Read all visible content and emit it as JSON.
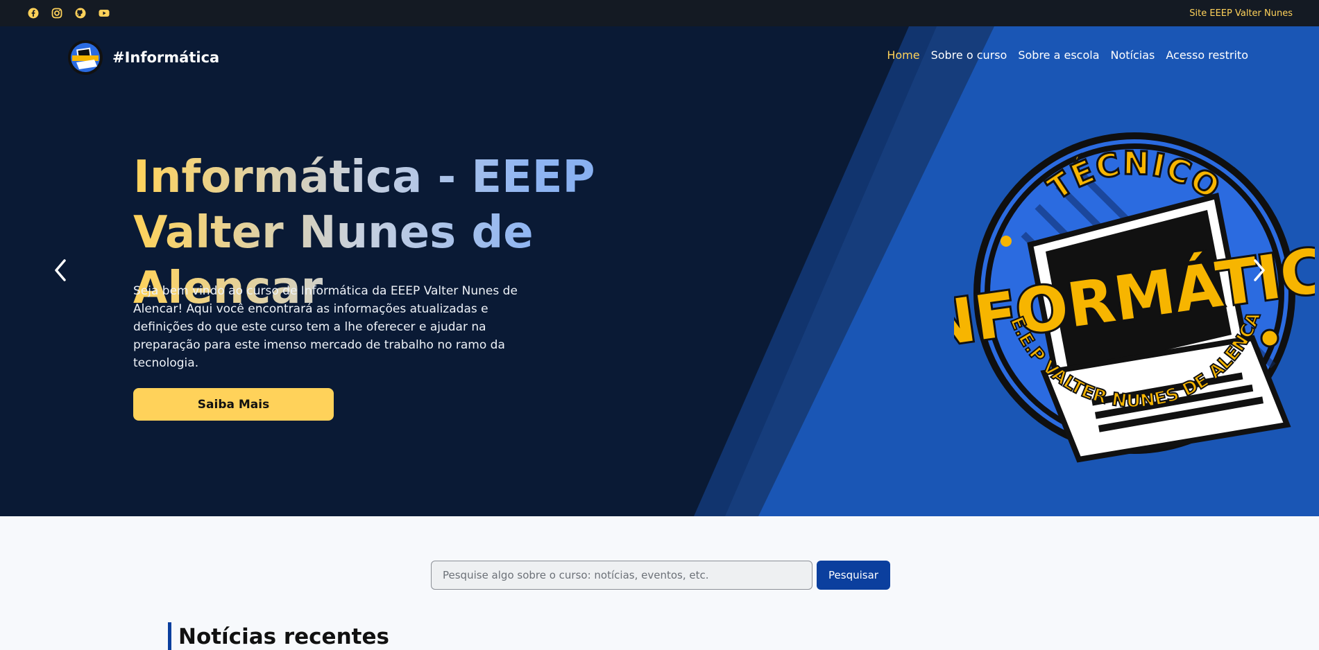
{
  "topbar": {
    "social": [
      "facebook-icon",
      "instagram-icon",
      "github-icon",
      "youtube-icon"
    ],
    "site_link": "Site EEEP Valter Nunes"
  },
  "header": {
    "brand": "#Informática",
    "nav": [
      "Home",
      "Sobre o curso",
      "Sobre a escola",
      "Notícias",
      "Acesso restrito"
    ],
    "active_nav": "Home"
  },
  "hero": {
    "title": "Informática - EEEP Valter Nunes de Alencar",
    "description": "Seja bem vindo ao curso de Informática da EEEP Valter Nunes de Alencar! Aqui você encontrará as informações atualizadas e definições do que este curso tem a lhe oferecer e ajudar na preparação para este imenso mercado de trabalho no ramo da tecnologia.",
    "cta": "Saiba Mais",
    "emblem": {
      "top": "TÉCNICO",
      "main": "INFORMÁTICA",
      "bottom": "E.E.E.P VALTER NUNES DE ALENCAR"
    }
  },
  "search": {
    "placeholder": "Pesquise algo sobre o curso: notícias, eventos, etc.",
    "button": "Pesquisar"
  },
  "section": {
    "title": "Notícias recentes"
  },
  "colors": {
    "accent": "#ffd25a",
    "hero_dark": "#0a1a35",
    "hero_blue": "#1a56b5",
    "primary": "#0b3f9e"
  }
}
